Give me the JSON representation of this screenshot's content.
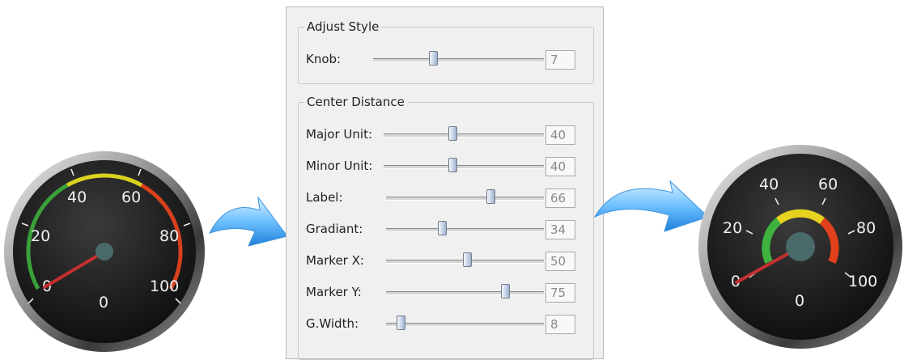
{
  "left_gauge": {
    "labels": [
      "0",
      "20",
      "40",
      "60",
      "80",
      "100"
    ],
    "bottom_label": "0",
    "value": 0
  },
  "right_gauge": {
    "labels": [
      "0",
      "20",
      "40",
      "60",
      "80",
      "100"
    ],
    "bottom_label": "0",
    "value": 0
  },
  "panel": {
    "adjust_style": {
      "title": "Adjust Style",
      "knob": {
        "label": "Knob:",
        "value": "7",
        "fraction": 0.36
      }
    },
    "center_distance": {
      "title": "Center Distance",
      "sliders": [
        {
          "label": "Major Unit:",
          "value": "40",
          "fraction": 0.4
        },
        {
          "label": "Minor Unit:",
          "value": "40",
          "fraction": 0.4
        },
        {
          "label": "Label:",
          "value": "66",
          "fraction": 0.66
        },
        {
          "label": "Gradiant:",
          "value": "34",
          "fraction": 0.34
        },
        {
          "label": "Marker X:",
          "value": "50",
          "fraction": 0.5
        },
        {
          "label": "Marker Y:",
          "value": "75",
          "fraction": 0.75
        },
        {
          "label": "G.Width:",
          "value": "8",
          "fraction": 0.08
        }
      ]
    }
  },
  "colors": {
    "arrow_light": "#b9e3ff",
    "arrow_dark": "#2a8fe6",
    "gauge_face": "#1a1a1a",
    "needle": "#c43030",
    "hub": "#4a6a6a"
  }
}
